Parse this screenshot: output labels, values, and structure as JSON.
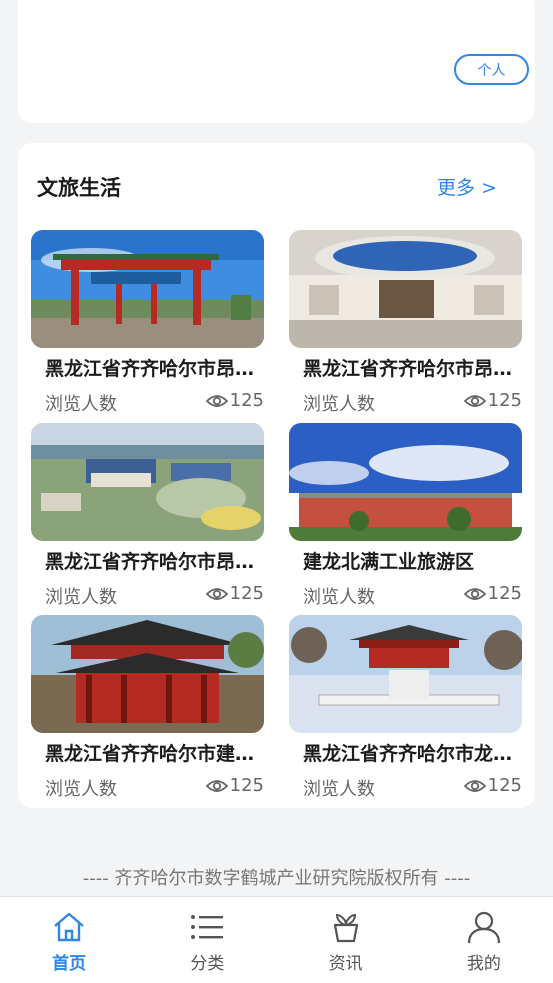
{
  "profile_card": {
    "personal_button": "个人"
  },
  "section": {
    "title": "文旅生活",
    "more": "更多 >"
  },
  "tiles": [
    {
      "title": "黑龙江省齐齐哈尔市昂昂溪区...",
      "sub": "浏览人数",
      "views": "125"
    },
    {
      "title": "黑龙江省齐齐哈尔市昂昂溪区...",
      "sub": "浏览人数",
      "views": "125"
    },
    {
      "title": "黑龙江省齐齐哈尔市昂昂溪区...",
      "sub": "浏览人数",
      "views": "125"
    },
    {
      "title": "建龙北满工业旅游区",
      "sub": "浏览人数",
      "views": "125"
    },
    {
      "title": "黑龙江省齐齐哈尔市建华区...",
      "sub": "浏览人数",
      "views": "125"
    },
    {
      "title": "黑龙江省齐齐哈尔市龙沙区...",
      "sub": "浏览人数",
      "views": "125"
    }
  ],
  "footer": {
    "copyright": "---- 齐齐哈尔市数字鹤城产业研究院版权所有 ----"
  },
  "tabbar": {
    "items": [
      {
        "label": "首页",
        "icon": "home-icon",
        "active": true
      },
      {
        "label": "分类",
        "icon": "list-icon",
        "active": false
      },
      {
        "label": "资讯",
        "icon": "sprout-icon",
        "active": false
      },
      {
        "label": "我的",
        "icon": "user-icon",
        "active": false
      }
    ]
  },
  "colors": {
    "accent": "#2f86e6",
    "background": "#f3f4f6",
    "card": "#ffffff"
  }
}
